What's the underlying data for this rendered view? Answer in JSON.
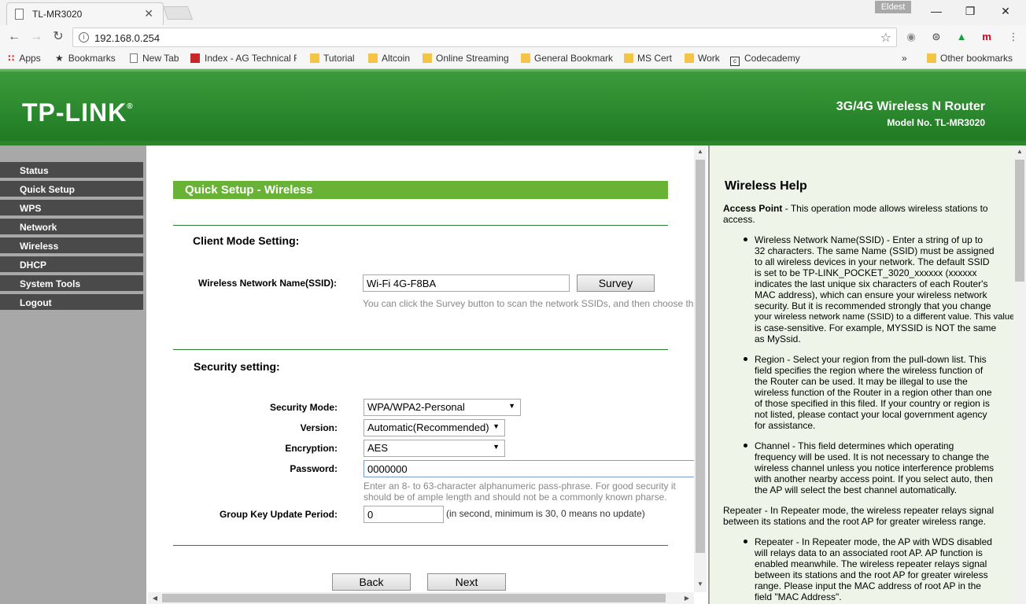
{
  "browser": {
    "tab_title": "TL-MR3020",
    "tab_close": "✕",
    "profile": "Eldest",
    "url": "192.168.0.254",
    "bookmarks": [
      "Apps",
      "Bookmarks",
      "New Tab",
      "Index - AG Technical F",
      "Tutorial",
      "Altcoin",
      "Online Streaming",
      "General Bookmark",
      "MS Cert",
      "Work",
      "Codecademy"
    ],
    "more": "»",
    "other_bookmarks": "Other bookmarks"
  },
  "router": {
    "logo": "TP-LINK",
    "logo_mark": "®",
    "product": "3G/4G Wireless N Router",
    "model": "Model No. TL-MR3020"
  },
  "menu": [
    "Status",
    "Quick Setup",
    "WPS",
    "Network",
    "Wireless",
    "DHCP",
    "System Tools",
    "Logout"
  ],
  "main": {
    "title": "Quick Setup - Wireless",
    "client_heading": "Client Mode Setting:",
    "ssid_label": "Wireless Network Name(SSID):",
    "ssid_value": "Wi-Fi 4G-F8BA",
    "survey": "Survey",
    "survey_hint": "You can click the Survey button to scan the network SSIDs, and then choose th",
    "security_heading": "Security setting:",
    "security_mode_label": "Security Mode:",
    "security_mode_value": "WPA/WPA2-Personal",
    "version_label": "Version:",
    "version_value": "Automatic(Recommended)",
    "encryption_label": "Encryption:",
    "encryption_value": "AES",
    "password_label": "Password:",
    "password_value": "0000000",
    "password_hint_1": "Enter an 8- to 63-character alphanumeric pass-phrase. For good security it",
    "password_hint_2": "should be of ample length and should not be a commonly known pharse.",
    "gkup_label": "Group Key Update Period:",
    "gkup_value": "0",
    "gkup_hint": "(in second, minimum is 30, 0 means no update)",
    "back": "Back",
    "next": "Next"
  },
  "help": {
    "title": "Wireless Help",
    "access_point_term": "Access Point",
    "access_point_l1": " - This operation mode allows wireless stations to",
    "access_point_l2": "access.",
    "ssid_lines": [
      "Wireless Network Name(SSID) - Enter a string of up to",
      "32 characters. The same Name (SSID) must be assigned",
      "to all wireless devices in your network. The default SSID",
      "is set to be TP-LINK_POCKET_3020_xxxxxx (xxxxxx",
      "indicates the last unique six characters of each Router's",
      "MAC address), which can ensure your wireless network",
      "security. But it is recommended strongly that you change",
      "your wireless network name (SSID) to a different value. This value",
      "is case-sensitive. For example, MYSSID is NOT the same",
      "as MySsid."
    ],
    "region_lines": [
      "Region - Select your region from the pull-down list. This",
      "field specifies the region where the wireless function of",
      "the Router can be used. It may be illegal to use the",
      "wireless function of the Router in a region other than one",
      "of those specified in this filed. If your country or region is",
      "not listed, please contact your local government agency",
      "for assistance."
    ],
    "channel_lines": [
      "Channel - This field determines which operating",
      "frequency will be used. It is not necessary to change the",
      "wireless channel unless you notice interference problems",
      "with another nearby access point. If you select auto, then",
      "the AP will select the best channel automatically."
    ],
    "repeater_lines": [
      "Repeater - In Repeater mode, the wireless repeater relays signal",
      "between its stations and the root AP for greater wireless range."
    ],
    "repeater2_lines": [
      "Repeater - In Repeater mode, the AP with WDS disabled",
      "will relays data to an associated root AP. AP function is",
      "enabled meanwhile. The wireless repeater relays signal",
      "between its stations and the root AP for greater wireless",
      "range. Please input the MAC address of root AP in the",
      "field \"MAC Address\"."
    ]
  }
}
